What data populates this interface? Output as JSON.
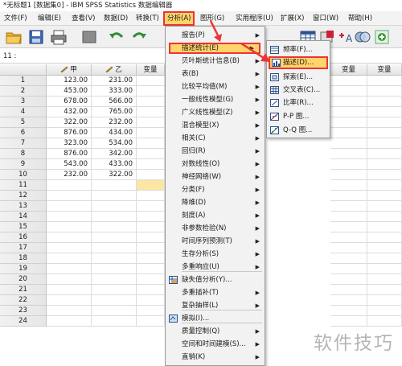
{
  "window": {
    "title": "*无标题1 [数据集0] - IBM SPSS Statistics 数据编辑器"
  },
  "menubar": {
    "items": [
      "文件(F)",
      "编辑(E)",
      "查看(V)",
      "数据(D)",
      "转换(T)",
      "分析(A)",
      "图形(G)",
      "实用程序(U)",
      "扩展(X)",
      "窗口(W)",
      "帮助(H)"
    ]
  },
  "cell_reference": "11 :",
  "grid": {
    "columns": [
      "甲",
      "乙",
      "变量"
    ],
    "rows": [
      {
        "n": "1",
        "a": "123.00",
        "b": "231.00"
      },
      {
        "n": "2",
        "a": "453.00",
        "b": "333.00"
      },
      {
        "n": "3",
        "a": "678.00",
        "b": "566.00"
      },
      {
        "n": "4",
        "a": "432.00",
        "b": "765.00"
      },
      {
        "n": "5",
        "a": "322.00",
        "b": "232.00"
      },
      {
        "n": "6",
        "a": "876.00",
        "b": "434.00"
      },
      {
        "n": "7",
        "a": "323.00",
        "b": "534.00"
      },
      {
        "n": "8",
        "a": "876.00",
        "b": "342.00"
      },
      {
        "n": "9",
        "a": "543.00",
        "b": "433.00"
      },
      {
        "n": "10",
        "a": "232.00",
        "b": "322.00"
      },
      {
        "n": "11",
        "a": "",
        "b": ""
      },
      {
        "n": "12",
        "a": "",
        "b": ""
      },
      {
        "n": "13",
        "a": "",
        "b": ""
      },
      {
        "n": "14",
        "a": "",
        "b": ""
      },
      {
        "n": "15",
        "a": "",
        "b": ""
      },
      {
        "n": "16",
        "a": "",
        "b": ""
      },
      {
        "n": "17",
        "a": "",
        "b": ""
      },
      {
        "n": "18",
        "a": "",
        "b": ""
      },
      {
        "n": "19",
        "a": "",
        "b": ""
      },
      {
        "n": "20",
        "a": "",
        "b": ""
      },
      {
        "n": "21",
        "a": "",
        "b": ""
      },
      {
        "n": "22",
        "a": "",
        "b": ""
      },
      {
        "n": "23",
        "a": "",
        "b": ""
      },
      {
        "n": "24",
        "a": "",
        "b": ""
      }
    ]
  },
  "analyze_menu": {
    "items": [
      {
        "label": "报告(P)",
        "arrow": true
      },
      {
        "label": "描述统计(E)",
        "arrow": true,
        "selected": true
      },
      {
        "label": "贝叶斯统计信息(B)",
        "arrow": true
      },
      {
        "label": "表(B)",
        "arrow": true
      },
      {
        "label": "比较平均值(M)",
        "arrow": true
      },
      {
        "label": "一般线性模型(G)",
        "arrow": true
      },
      {
        "label": "广义线性模型(Z)",
        "arrow": true
      },
      {
        "label": "混合模型(X)",
        "arrow": true
      },
      {
        "label": "相关(C)",
        "arrow": true
      },
      {
        "label": "回归(R)",
        "arrow": true
      },
      {
        "label": "对数线性(O)",
        "arrow": true
      },
      {
        "label": "神经网络(W)",
        "arrow": true
      },
      {
        "label": "分类(F)",
        "arrow": true
      },
      {
        "label": "降维(D)",
        "arrow": true
      },
      {
        "label": "刻度(A)",
        "arrow": true
      },
      {
        "label": "非参数检验(N)",
        "arrow": true
      },
      {
        "label": "时间序列预测(T)",
        "arrow": true
      },
      {
        "label": "生存分析(S)",
        "arrow": true
      },
      {
        "label": "多重响应(U)",
        "arrow": true
      },
      {
        "label": "缺失值分析(Y)...",
        "arrow": false,
        "icon": "missing-values-icon"
      },
      {
        "label": "多重插补(T)",
        "arrow": true
      },
      {
        "label": "复杂抽样(L)",
        "arrow": true
      },
      {
        "label": "模拟(I)...",
        "arrow": false,
        "icon": "simulation-icon"
      },
      {
        "label": "质量控制(Q)",
        "arrow": true
      },
      {
        "label": "空间和时间建模(S)...",
        "arrow": true
      },
      {
        "label": "直销(K)",
        "arrow": true
      }
    ]
  },
  "descriptive_submenu": {
    "items": [
      {
        "label": "频率(F)...",
        "icon": "frequencies-icon"
      },
      {
        "label": "描述(D)...",
        "icon": "descriptives-icon",
        "selected": true
      },
      {
        "label": "探索(E)...",
        "icon": "explore-icon"
      },
      {
        "label": "交叉表(C)...",
        "icon": "crosstabs-icon"
      },
      {
        "label": "比率(R)...",
        "icon": "ratio-icon"
      },
      {
        "label": "P-P 图...",
        "icon": "pp-plot-icon"
      },
      {
        "label": "Q-Q 图...",
        "icon": "qq-plot-icon"
      }
    ]
  },
  "watermark": "软件技巧",
  "colors": {
    "highlight": "#ffd46b",
    "highlight_border": "#e33333",
    "annotation_arrow": "#e33333"
  }
}
